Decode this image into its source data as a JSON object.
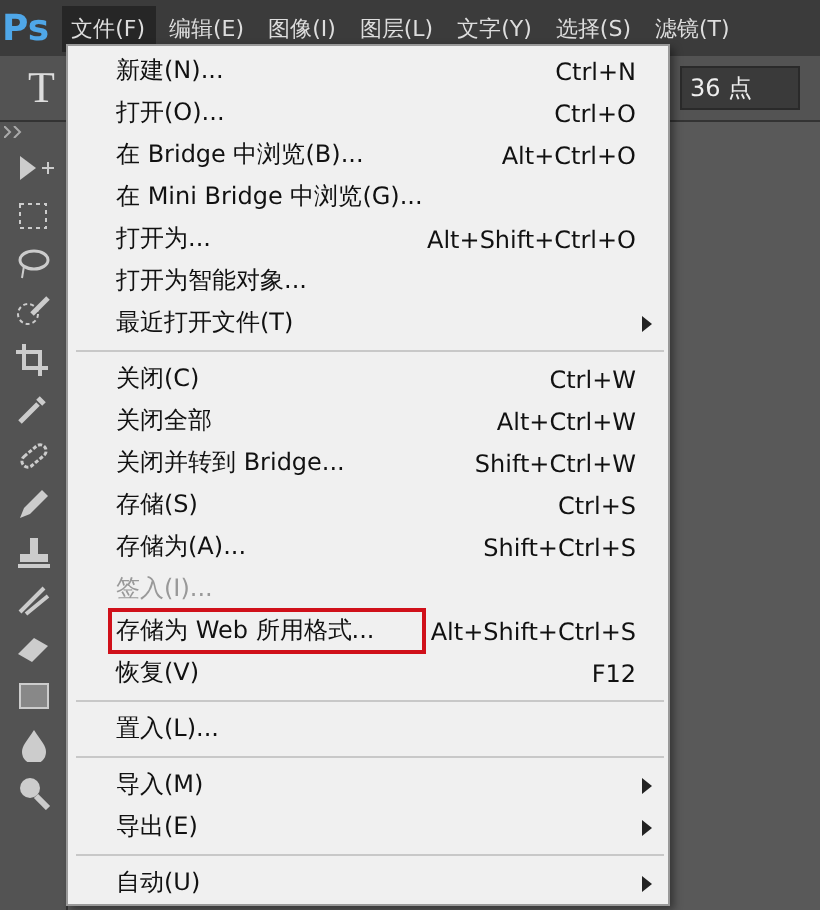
{
  "app_logo": "Ps",
  "menubar": [
    {
      "label": "文件(F)",
      "selected": true
    },
    {
      "label": "编辑(E)",
      "selected": false
    },
    {
      "label": "图像(I)",
      "selected": false
    },
    {
      "label": "图层(L)",
      "selected": false
    },
    {
      "label": "文字(Y)",
      "selected": false
    },
    {
      "label": "选择(S)",
      "selected": false
    },
    {
      "label": "滤镜(T)",
      "selected": false
    }
  ],
  "options_bar": {
    "tool_glyph": "T",
    "font_size": "36 点"
  },
  "menu": [
    {
      "kind": "item",
      "label": "新建(N)...",
      "shortcut": "Ctrl+N",
      "submenu": false,
      "disabled": false,
      "highlighted": false
    },
    {
      "kind": "item",
      "label": "打开(O)...",
      "shortcut": "Ctrl+O",
      "submenu": false,
      "disabled": false,
      "highlighted": false
    },
    {
      "kind": "item",
      "label": "在 Bridge 中浏览(B)...",
      "shortcut": "Alt+Ctrl+O",
      "submenu": false,
      "disabled": false,
      "highlighted": false
    },
    {
      "kind": "item",
      "label": "在 Mini Bridge 中浏览(G)...",
      "submenu": false,
      "disabled": false,
      "highlighted": false
    },
    {
      "kind": "item",
      "label": "打开为...",
      "shortcut": "Alt+Shift+Ctrl+O",
      "submenu": false,
      "disabled": false,
      "highlighted": false
    },
    {
      "kind": "item",
      "label": "打开为智能对象...",
      "submenu": false,
      "disabled": false,
      "highlighted": false
    },
    {
      "kind": "item",
      "label": "最近打开文件(T)",
      "submenu": true,
      "disabled": false,
      "highlighted": false
    },
    {
      "kind": "separator"
    },
    {
      "kind": "item",
      "label": "关闭(C)",
      "shortcut": "Ctrl+W",
      "submenu": false,
      "disabled": false,
      "highlighted": false
    },
    {
      "kind": "item",
      "label": "关闭全部",
      "shortcut": "Alt+Ctrl+W",
      "submenu": false,
      "disabled": false,
      "highlighted": false
    },
    {
      "kind": "item",
      "label": "关闭并转到 Bridge...",
      "shortcut": "Shift+Ctrl+W",
      "submenu": false,
      "disabled": false,
      "highlighted": false
    },
    {
      "kind": "item",
      "label": "存储(S)",
      "shortcut": "Ctrl+S",
      "submenu": false,
      "disabled": false,
      "highlighted": false
    },
    {
      "kind": "item",
      "label": "存储为(A)...",
      "shortcut": "Shift+Ctrl+S",
      "submenu": false,
      "disabled": false,
      "highlighted": false
    },
    {
      "kind": "item",
      "label": "签入(I)...",
      "submenu": false,
      "disabled": true,
      "highlighted": false
    },
    {
      "kind": "item",
      "label": "存储为 Web 所用格式...",
      "shortcut": "Alt+Shift+Ctrl+S",
      "submenu": false,
      "disabled": false,
      "highlighted": true
    },
    {
      "kind": "item",
      "label": "恢复(V)",
      "shortcut": "F12",
      "submenu": false,
      "disabled": false,
      "highlighted": false
    },
    {
      "kind": "separator"
    },
    {
      "kind": "item",
      "label": "置入(L)...",
      "submenu": false,
      "disabled": false,
      "highlighted": false
    },
    {
      "kind": "separator"
    },
    {
      "kind": "item",
      "label": "导入(M)",
      "submenu": true,
      "disabled": false,
      "highlighted": false
    },
    {
      "kind": "item",
      "label": "导出(E)",
      "submenu": true,
      "disabled": false,
      "highlighted": false
    },
    {
      "kind": "separator"
    },
    {
      "kind": "item",
      "label": "自动(U)",
      "submenu": true,
      "disabled": false,
      "highlighted": false
    }
  ]
}
